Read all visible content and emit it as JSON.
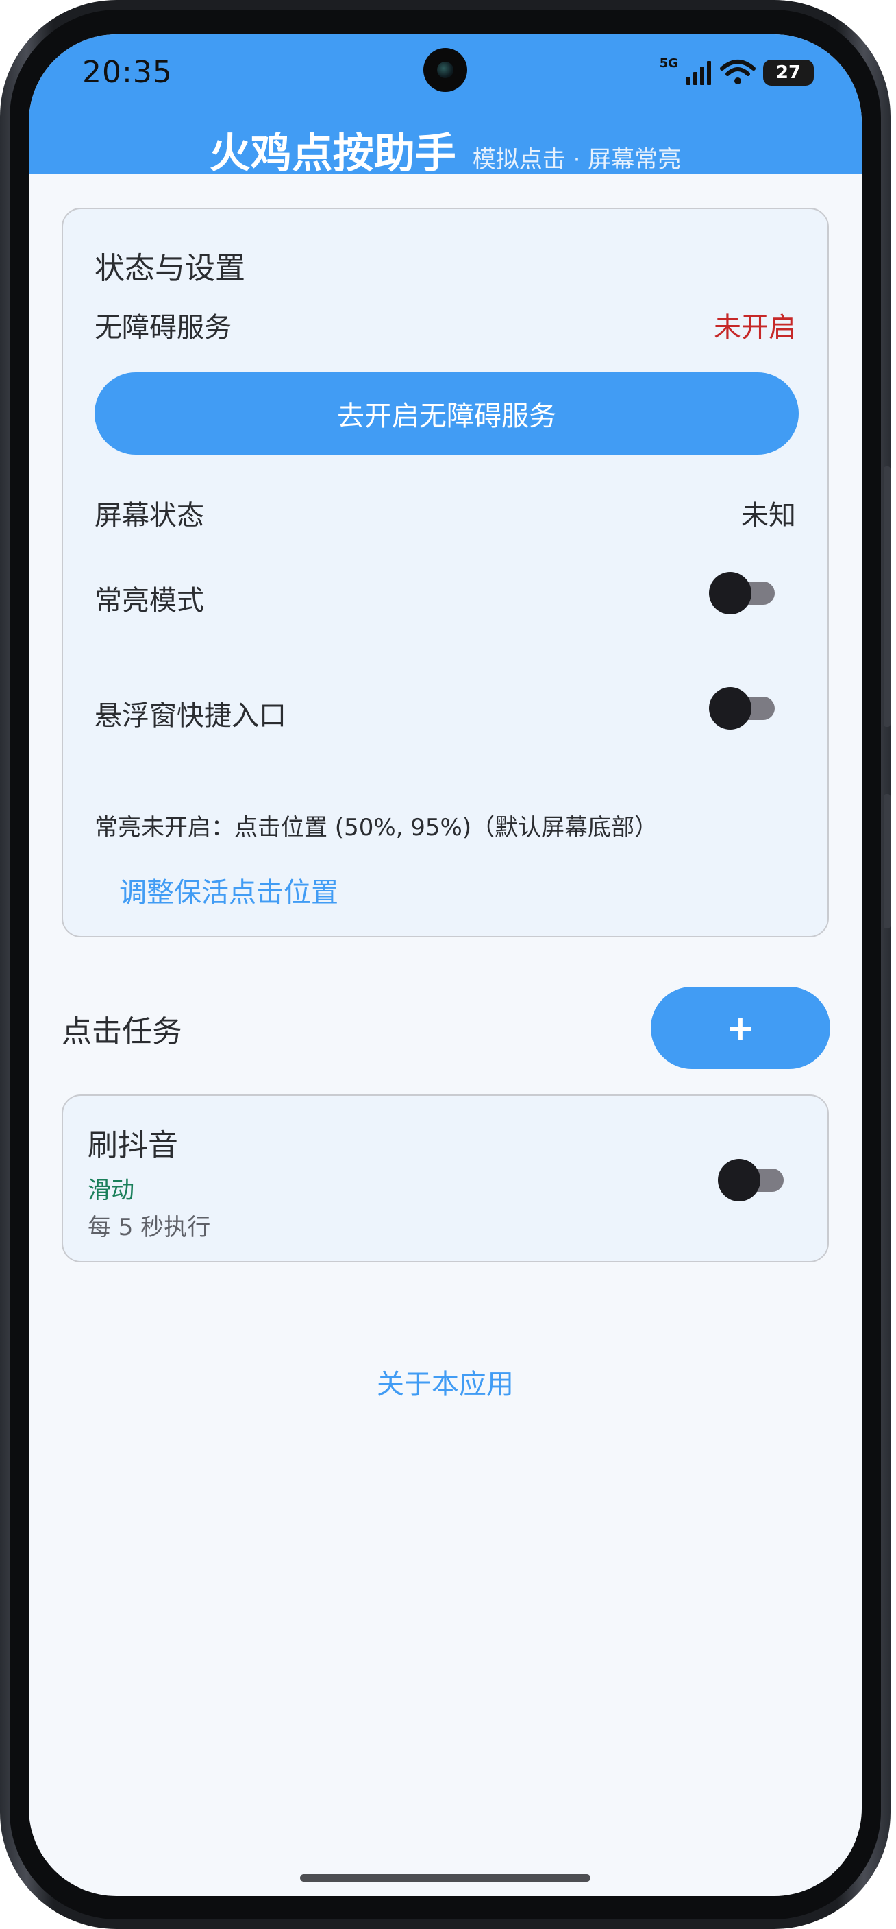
{
  "status_bar": {
    "time": "20:35",
    "network": "5G",
    "battery": "27"
  },
  "header": {
    "title": "火鸡点按助手",
    "subtitle": "模拟点击 · 屏幕常亮"
  },
  "settings": {
    "title": "状态与设置",
    "accessibility_label": "无障碍服务",
    "accessibility_status": "未开启",
    "accessibility_status_color": "#c62828",
    "enable_button": "去开启无障碍服务",
    "screen_state_label": "屏幕状态",
    "screen_state_value": "未知",
    "keep_awake_label": "常亮模式",
    "keep_awake_on": false,
    "floating_label": "悬浮窗快捷入口",
    "floating_on": false,
    "hint": "常亮未开启：点击位置 (50%, 95%)（默认屏幕底部）",
    "adjust_link": "调整保活点击位置"
  },
  "tasks": {
    "title": "点击任务",
    "add_button": "+",
    "items": [
      {
        "name": "刷抖音",
        "type": "滑动",
        "type_color": "#1a7f5a",
        "interval": "每 5 秒执行",
        "enabled": false
      }
    ]
  },
  "footer": {
    "about_link": "关于本应用"
  },
  "colors": {
    "accent": "#419cf4",
    "card_bg": "#edf4fc",
    "page_bg": "#f5f8fc"
  }
}
